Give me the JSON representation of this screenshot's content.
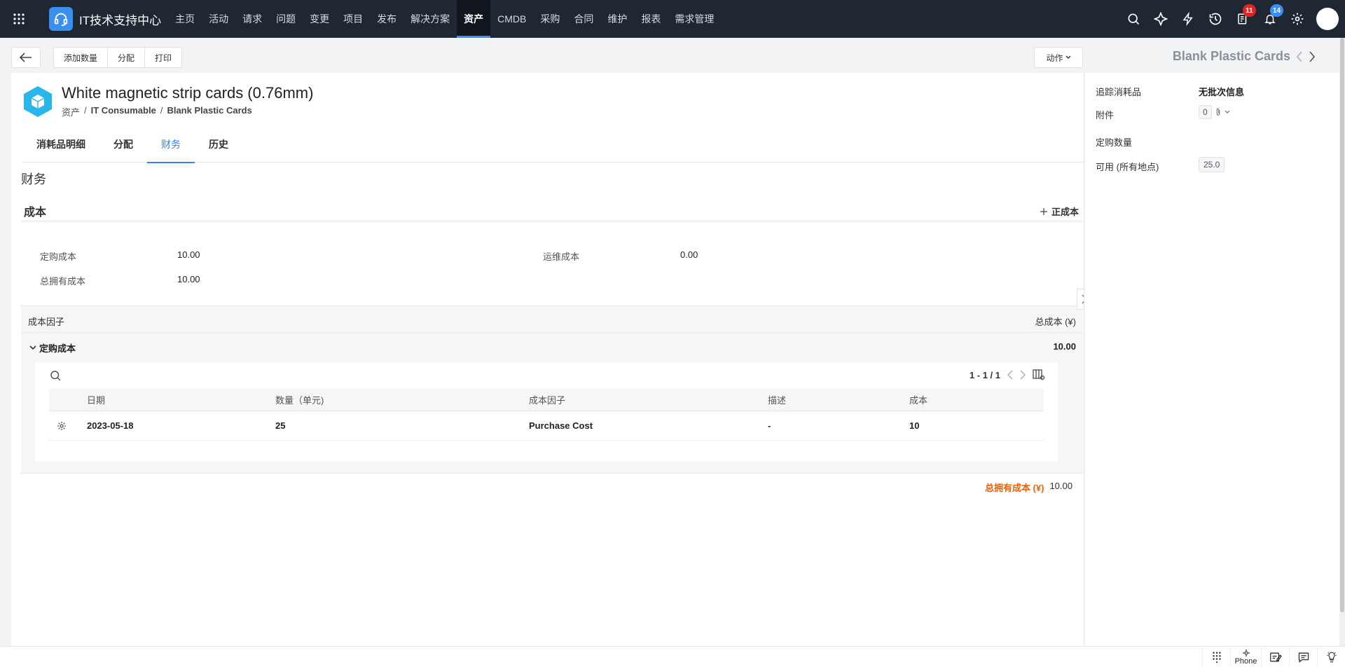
{
  "app": {
    "title": "IT技术支持中心"
  },
  "nav": {
    "items": [
      "主页",
      "活动",
      "请求",
      "问题",
      "变更",
      "项目",
      "发布",
      "解决方案",
      "资产",
      "CMDB",
      "采购",
      "合同",
      "维护",
      "报表",
      "需求管理"
    ],
    "active_index": 8
  },
  "topbar": {
    "tasks_badge": "11",
    "notifications_badge": "14"
  },
  "toolbar": {
    "buttons": [
      "添加数量",
      "分配",
      "打印"
    ],
    "action_label": "动作"
  },
  "right_header": {
    "title": "Blank Plastic Cards"
  },
  "asset": {
    "title": "White magnetic strip cards (0.76mm)",
    "breadcrumb": [
      "资产",
      "IT Consumable",
      "Blank Plastic Cards"
    ]
  },
  "tabs": [
    "消耗品明细",
    "分配",
    "财务",
    "历史"
  ],
  "active_tab": 2,
  "finance": {
    "section_title": "财务",
    "cost_title": "成本",
    "add_cost_label": "正成本",
    "purchase_cost_label": "定购成本",
    "purchase_cost_value": "10.00",
    "maintenance_cost_label": "运维成本",
    "maintenance_cost_value": "0.00",
    "tco_label": "总拥有成本",
    "tco_value": "10.00"
  },
  "factor_table": {
    "header_left": "成本因子",
    "header_right": "总成本 (¥)",
    "group_label": "定购成本",
    "group_value": "10.00",
    "pager": "1 - 1 / 1",
    "columns": [
      "日期",
      "数量（单元)",
      "成本因子",
      "描述",
      "成本"
    ],
    "rows": [
      {
        "date": "2023-05-18",
        "qty": "25",
        "factor": "Purchase Cost",
        "desc": "-",
        "cost": "10"
      }
    ]
  },
  "total_line": {
    "label": "总拥有成本 (¥)",
    "value": "10.00"
  },
  "right_panel": {
    "track_label": "追踪消耗品",
    "track_value": "无批次信息",
    "attach_label": "附件",
    "attach_count": "0",
    "order_qty_label": "定购数量",
    "available_label": "可用 (所有地点)",
    "available_value": "25.0"
  },
  "statusbar": {
    "phone_label": "Phone"
  }
}
